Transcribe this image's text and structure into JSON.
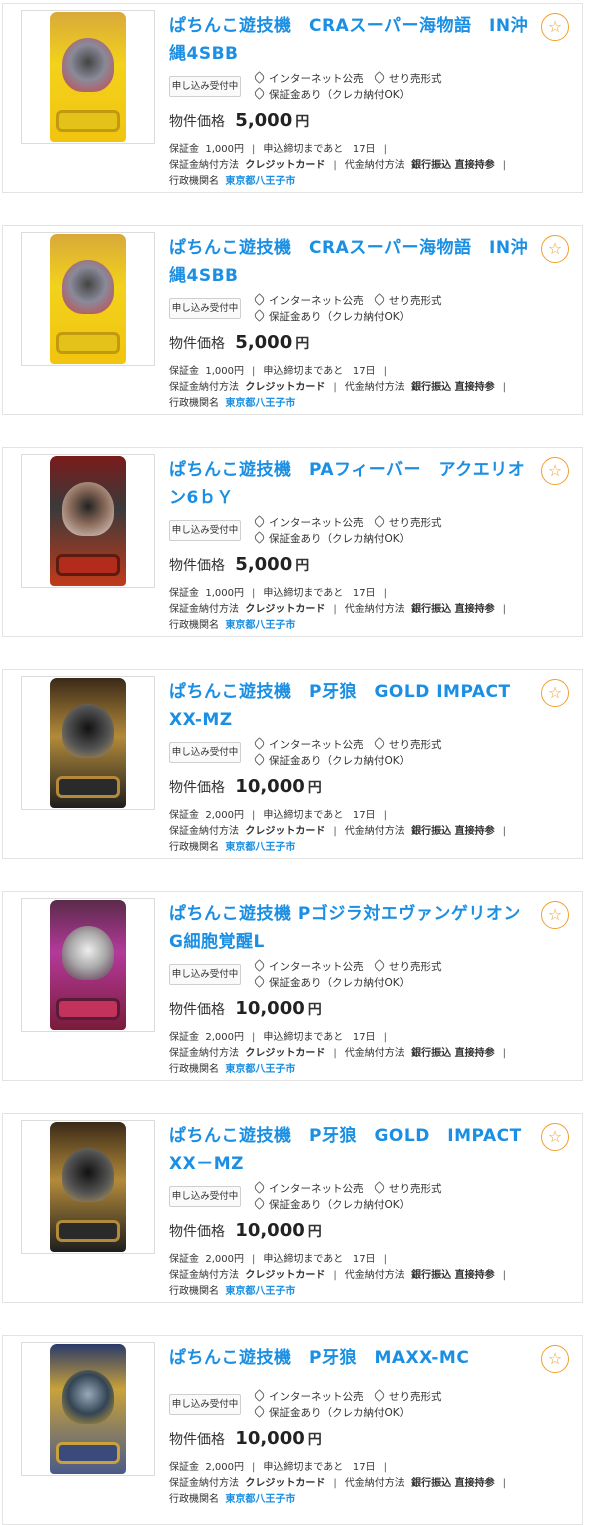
{
  "listings": [
    {
      "title": "ぱちんこ遊技機　CRAスーパー海物語　IN沖縄4SBB",
      "image_alt": "パチンコ台（黄色）",
      "image_theme": "yellow",
      "badge": "申し込み受付中",
      "tag1": "インターネット公売",
      "tag2": "せり売形式",
      "tag3": "保証金あり（クレカ納付OK）",
      "price_label": "物件価格",
      "price": "5,000",
      "price_unit": "円",
      "deposit_label": "保証金",
      "deposit": "1,000円",
      "deadline_label": "申込締切まであと",
      "deadline": "17日",
      "deposit_method_label": "保証金納付方法",
      "deposit_method": "クレジットカード",
      "payment_label": "代金納付方法",
      "payment": "銀行振込 直接持参",
      "agency_label": "行政機関名",
      "agency": "東京都八王子市"
    },
    {
      "title": "ぱちんこ遊技機　CRAスーパー海物語　IN沖縄4SBB",
      "image_alt": "パチンコ台（黄色）",
      "image_theme": "yellow",
      "badge": "申し込み受付中",
      "tag1": "インターネット公売",
      "tag2": "せり売形式",
      "tag3": "保証金あり（クレカ納付OK）",
      "price_label": "物件価格",
      "price": "5,000",
      "price_unit": "円",
      "deposit_label": "保証金",
      "deposit": "1,000円",
      "deadline_label": "申込締切まであと",
      "deadline": "17日",
      "deposit_method_label": "保証金納付方法",
      "deposit_method": "クレジットカード",
      "payment_label": "代金納付方法",
      "payment": "銀行振込 直接持参",
      "agency_label": "行政機関名",
      "agency": "東京都八王子市"
    },
    {
      "title": "ぱちんこ遊技機　PAフィーバー　アクエリオン6ｂＹ",
      "image_alt": "パチンコ台（赤）",
      "image_theme": "red",
      "badge": "申し込み受付中",
      "tag1": "インターネット公売",
      "tag2": "せり売形式",
      "tag3": "保証金あり（クレカ納付OK）",
      "price_label": "物件価格",
      "price": "5,000",
      "price_unit": "円",
      "deposit_label": "保証金",
      "deposit": "1,000円",
      "deadline_label": "申込締切まであと",
      "deadline": "17日",
      "deposit_method_label": "保証金納付方法",
      "deposit_method": "クレジットカード",
      "payment_label": "代金納付方法",
      "payment": "銀行振込 直接持参",
      "agency_label": "行政機関名",
      "agency": "東京都八王子市"
    },
    {
      "title": "ぱちんこ遊技機　P牙狼　GOLD IMPACT　XX-MZ",
      "image_alt": "パチンコ台（金）",
      "image_theme": "gold",
      "badge": "申し込み受付中",
      "tag1": "インターネット公売",
      "tag2": "せり売形式",
      "tag3": "保証金あり（クレカ納付OK）",
      "price_label": "物件価格",
      "price": "10,000",
      "price_unit": "円",
      "deposit_label": "保証金",
      "deposit": "2,000円",
      "deadline_label": "申込締切まであと",
      "deadline": "17日",
      "deposit_method_label": "保証金納付方法",
      "deposit_method": "クレジットカード",
      "payment_label": "代金納付方法",
      "payment": "銀行振込 直接持参",
      "agency_label": "行政機関名",
      "agency": "東京都八王子市"
    },
    {
      "title": "ぱちんこ遊技機 Pゴジラ対エヴァンゲリオン　G細胞覚醒L",
      "image_alt": "パチンコ台（紫）",
      "image_theme": "purple",
      "badge": "申し込み受付中",
      "tag1": "インターネット公売",
      "tag2": "せり売形式",
      "tag3": "保証金あり（クレカ納付OK）",
      "price_label": "物件価格",
      "price": "10,000",
      "price_unit": "円",
      "deposit_label": "保証金",
      "deposit": "2,000円",
      "deadline_label": "申込締切まであと",
      "deadline": "17日",
      "deposit_method_label": "保証金納付方法",
      "deposit_method": "クレジットカード",
      "payment_label": "代金納付方法",
      "payment": "銀行振込 直接持参",
      "agency_label": "行政機関名",
      "agency": "東京都八王子市"
    },
    {
      "title": "ぱちんこ遊技機　P牙狼　GOLD　IMPACT　XX－MZ",
      "image_alt": "パチンコ台（金）",
      "image_theme": "gold",
      "badge": "申し込み受付中",
      "tag1": "インターネット公売",
      "tag2": "せり売形式",
      "tag3": "保証金あり（クレカ納付OK）",
      "price_label": "物件価格",
      "price": "10,000",
      "price_unit": "円",
      "deposit_label": "保証金",
      "deposit": "2,000円",
      "deadline_label": "申込締切まであと",
      "deadline": "17日",
      "deposit_method_label": "保証金納付方法",
      "deposit_method": "クレジットカード",
      "payment_label": "代金納付方法",
      "payment": "銀行振込 直接持参",
      "agency_label": "行政機関名",
      "agency": "東京都八王子市"
    },
    {
      "title": "ぱちんこ遊技機　P牙狼　MAXX-MC",
      "image_alt": "パチンコ台（青）",
      "image_theme": "blue",
      "badge": "申し込み受付中",
      "tag1": "インターネット公売",
      "tag2": "せり売形式",
      "tag3": "保証金あり（クレカ納付OK）",
      "price_label": "物件価格",
      "price": "10,000",
      "price_unit": "円",
      "deposit_label": "保証金",
      "deposit": "2,000円",
      "deadline_label": "申込締切まであと",
      "deadline": "17日",
      "deposit_method_label": "保証金納付方法",
      "deposit_method": "クレジットカード",
      "payment_label": "代金納付方法",
      "payment": "銀行振込 直接持参",
      "agency_label": "行政機関名",
      "agency": "東京都八王子市"
    }
  ],
  "favorite_icon": "star-outline-icon",
  "colors": {
    "title": "#1a8fe3",
    "favorite": "#f0a030",
    "border": "#e3e3e3"
  }
}
